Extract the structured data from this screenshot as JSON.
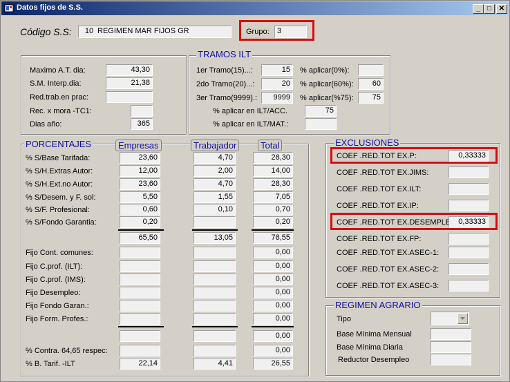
{
  "window": {
    "title": "Datos fijos de S.S.",
    "min": "_",
    "max": "□",
    "close": "✕"
  },
  "header": {
    "codigo_label": "Código S.S:",
    "codigo_num": "10",
    "codigo_desc": "REGIMEN MAR FIJOS GR",
    "grupo_label": "Grupo:",
    "grupo_value": "3"
  },
  "left_top": {
    "rows": [
      {
        "label": "Maximo A.T. dia:",
        "value": "43,30"
      },
      {
        "label": "S.M. Interp.dia:",
        "value": "21,38"
      },
      {
        "label": "Red.trab.en prac:",
        "value": ""
      },
      {
        "label": "Rec. x mora -TC1:",
        "value": ""
      },
      {
        "label": "Dias año:",
        "value": "365"
      }
    ]
  },
  "tramos": {
    "title": "TRAMOS ILT",
    "rows": [
      {
        "label": "1er Tramo(15)...:",
        "value": "15",
        "pct_label": "% aplicar(0%):",
        "pct_value": ""
      },
      {
        "label": "2do Tramo(20)...:",
        "value": "20",
        "pct_label": "% aplicar(60%):",
        "pct_value": "60"
      },
      {
        "label": "3er Tramo(9999).:",
        "value": "9999",
        "pct_label": "% aplicar(%75):",
        "pct_value": "75"
      }
    ],
    "acc_label": "% aplicar en ILT/ACC.",
    "acc_value": "75",
    "mat_label": "% aplicar en ILT/MAT.:",
    "mat_value": ""
  },
  "porcentajes": {
    "title": "PORCENTAJES",
    "col_emp": "Empresas",
    "col_trab": "Trabajador",
    "col_total": "Total",
    "rows": [
      {
        "label": "% S/Base Tarifada:",
        "emp": "23,60",
        "trab": "4,70",
        "total": "28,30"
      },
      {
        "label": "% S/H.Extras Autor:",
        "emp": "12,00",
        "trab": "2,00",
        "total": "14,00"
      },
      {
        "label": "% S/H.Ext.no Autor:",
        "emp": "23,60",
        "trab": "4,70",
        "total": "28,30"
      },
      {
        "label": "% S/Desem. y F. sol:",
        "emp": "5,50",
        "trab": "1,55",
        "total": "7,05"
      },
      {
        "label": "% S/F. Profesional:",
        "emp": "0,60",
        "trab": "0,10",
        "total": "0,70"
      },
      {
        "label": "% S/Fondo Garantia:",
        "emp": "0,20",
        "trab": "",
        "total": "0,20"
      }
    ],
    "sum1": {
      "emp": "65,50",
      "trab": "13,05",
      "total": "78,55"
    },
    "fijos": [
      {
        "label": "Fijo Cont. comunes:",
        "emp": "",
        "trab": "",
        "total": "0,00"
      },
      {
        "label": "Fijo    C.prof. (ILT):",
        "emp": "",
        "trab": "",
        "total": "0,00"
      },
      {
        "label": "Fijo    C.prof. (IMS):",
        "emp": "",
        "trab": "",
        "total": "0,00"
      },
      {
        "label": "Fijo   Desempleo:",
        "emp": "",
        "trab": "",
        "total": "0,00"
      },
      {
        "label": "Fijo   Fondo Garan.:",
        "emp": "",
        "trab": "",
        "total": "0,00"
      },
      {
        "label": "Fijo Form. Profes.:",
        "emp": "",
        "trab": "",
        "total": "0,00"
      }
    ],
    "sum2": {
      "emp": "",
      "trab": "",
      "total": "0,00"
    },
    "contra": {
      "label": "% Contra. 64,65 respec:",
      "emp": "",
      "trab": "",
      "total": "0,00"
    },
    "btarif": {
      "label": "% B. Tarif. -ILT",
      "emp": "22,14",
      "trab": "4,41",
      "total": "26,55"
    }
  },
  "exclusiones": {
    "title": "EXCLUSIONES",
    "rows": [
      {
        "label": "COEF .RED.TOT EX.P:",
        "value": "0,33333"
      },
      {
        "label": "COEF .RED.TOT EX.JIMS:",
        "value": ""
      },
      {
        "label": "COEF .RED.TOT EX.ILT:",
        "value": ""
      },
      {
        "label": "COEF .RED.TOT EX.IP:",
        "value": ""
      },
      {
        "label": "COEF .RED.TOT EX.DESEMPLEO:",
        "value": "0,33333"
      },
      {
        "label": "COEF .RED.TOT EX.FP:",
        "value": ""
      },
      {
        "label": "COEF .RED.TOT EX.ASEC-1:",
        "value": ""
      },
      {
        "label": "COEF .RED.TOT EX.ASEC-2:",
        "value": ""
      },
      {
        "label": "COEF .RED.TOT EX.ASEC-3:",
        "value": ""
      }
    ]
  },
  "agrario": {
    "title": "REGIMEN AGRARIO",
    "tipo_label": "Tipo",
    "tipo_value": "",
    "rows": [
      {
        "label": "Base Mínima Mensual",
        "value": ""
      },
      {
        "label": "Base Mínima Diaria",
        "value": ""
      },
      {
        "label": "Reductor Desempleo",
        "value": ""
      }
    ]
  },
  "colors": {
    "highlight": "#d01010",
    "group_title": "#1010a0",
    "title_bar": "#0a246a"
  }
}
